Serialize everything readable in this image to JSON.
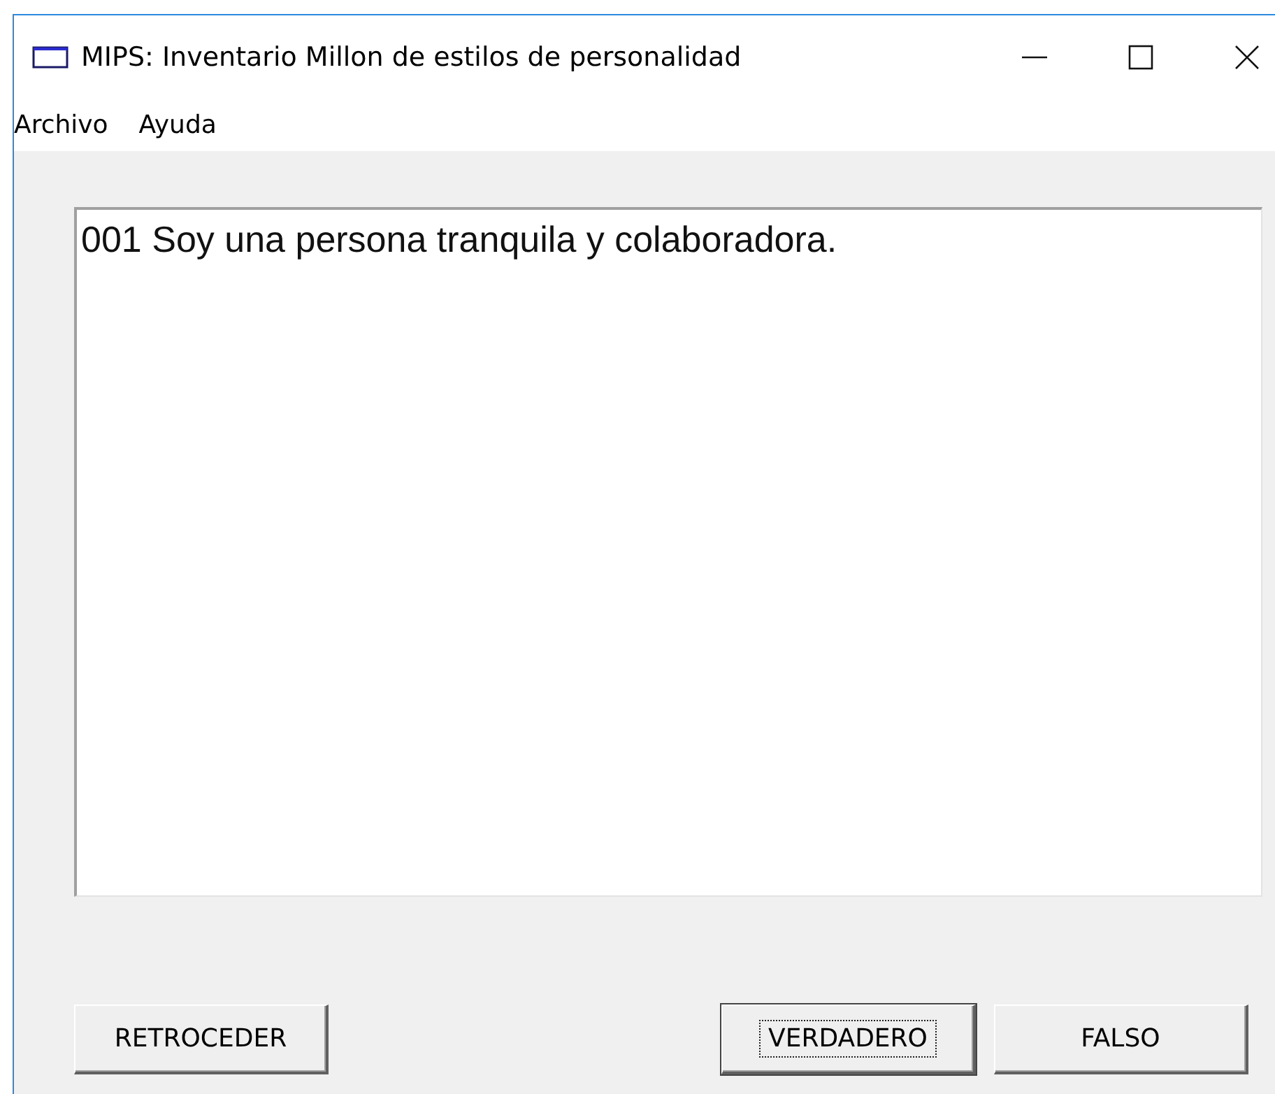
{
  "window": {
    "title": "MIPS: Inventario Millon de estilos de personalidad"
  },
  "menu": [
    "Archivo",
    "Ayuda"
  ],
  "question": {
    "text": "001 Soy una persona tranquila y colaboradora."
  },
  "buttons": [
    {
      "label": "RETROCEDER",
      "focused": false,
      "kind": "back"
    },
    {
      "label": "VERDADERO",
      "focused": true,
      "kind": "answer"
    },
    {
      "label": "FALSO",
      "focused": false,
      "kind": "answer"
    }
  ]
}
